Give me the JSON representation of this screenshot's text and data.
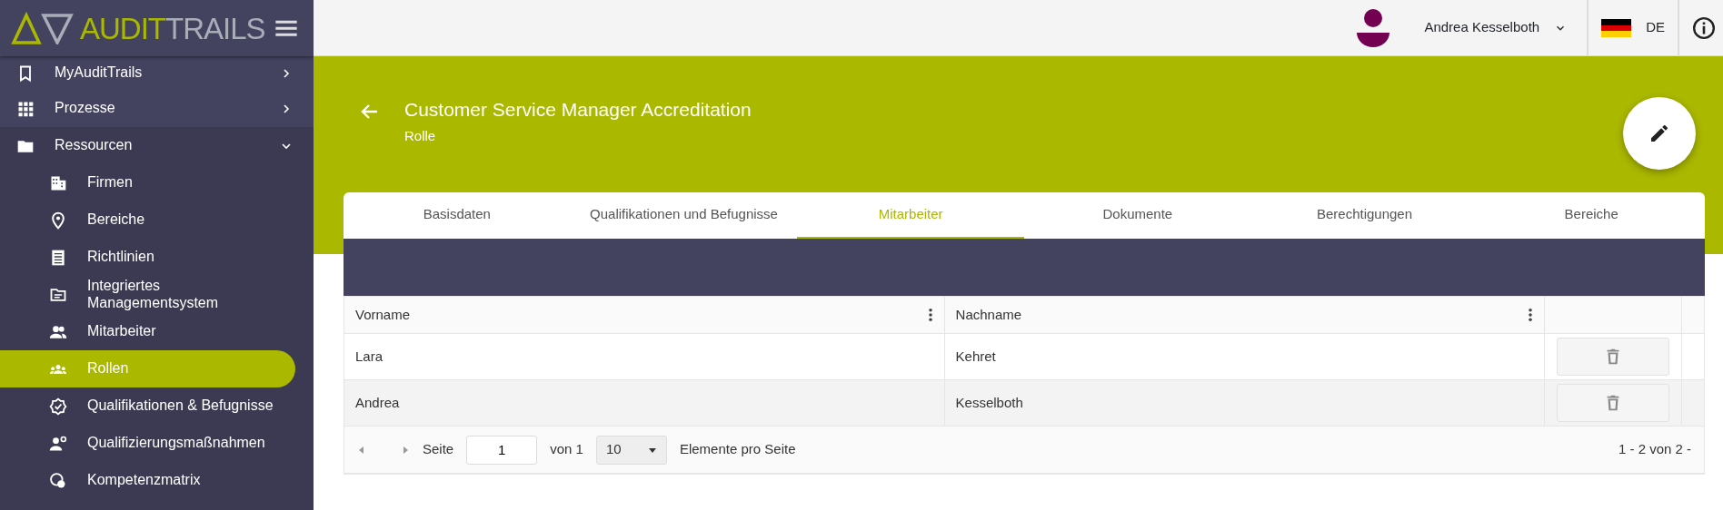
{
  "sidebar": {
    "logo": {
      "part_1": "AUDIT",
      "part_2": "TRAILS"
    },
    "items": [
      {
        "label": "MyAuditTrails",
        "expanded": false
      },
      {
        "label": "Prozesse",
        "expanded": false
      },
      {
        "label": "Ressourcen",
        "expanded": true,
        "children": [
          {
            "label": "Firmen",
            "selected": false
          },
          {
            "label": "Bereiche",
            "selected": false
          },
          {
            "label": "Richtlinien",
            "selected": false
          },
          {
            "label": "Integriertes Managementsystem",
            "selected": false
          },
          {
            "label": "Mitarbeiter",
            "selected": false
          },
          {
            "label": "Rollen",
            "selected": true
          },
          {
            "label": "Qualifikationen & Befugnisse",
            "selected": false
          },
          {
            "label": "Qualifizierungsmaßnahmen",
            "selected": false
          },
          {
            "label": "Kompetenzmatrix",
            "selected": false
          }
        ]
      }
    ]
  },
  "topbar": {
    "user": "Andrea Kesselboth",
    "language": "DE"
  },
  "header": {
    "title": "Customer Service Manager Accreditation",
    "subtitle": "Rolle"
  },
  "tabs": [
    {
      "label": "Basisdaten",
      "selected": false
    },
    {
      "label": "Qualifikationen und Befugnisse",
      "selected": false
    },
    {
      "label": "Mitarbeiter",
      "selected": true
    },
    {
      "label": "Dokumente",
      "selected": false
    },
    {
      "label": "Berechtigungen",
      "selected": false
    },
    {
      "label": "Bereiche",
      "selected": false
    }
  ],
  "table": {
    "columns": [
      "Vorname",
      "Nachname"
    ],
    "rows": [
      {
        "cells": [
          "Lara",
          "Kehret"
        ]
      },
      {
        "cells": [
          "Andrea",
          "Kesselboth"
        ]
      }
    ]
  },
  "pager": {
    "page_label": "Seite",
    "page": "1",
    "of_label": "von 1",
    "page_size": "10",
    "per_page_label": "Elemente pro Seite",
    "range": "1 - 2 von 2 -"
  }
}
